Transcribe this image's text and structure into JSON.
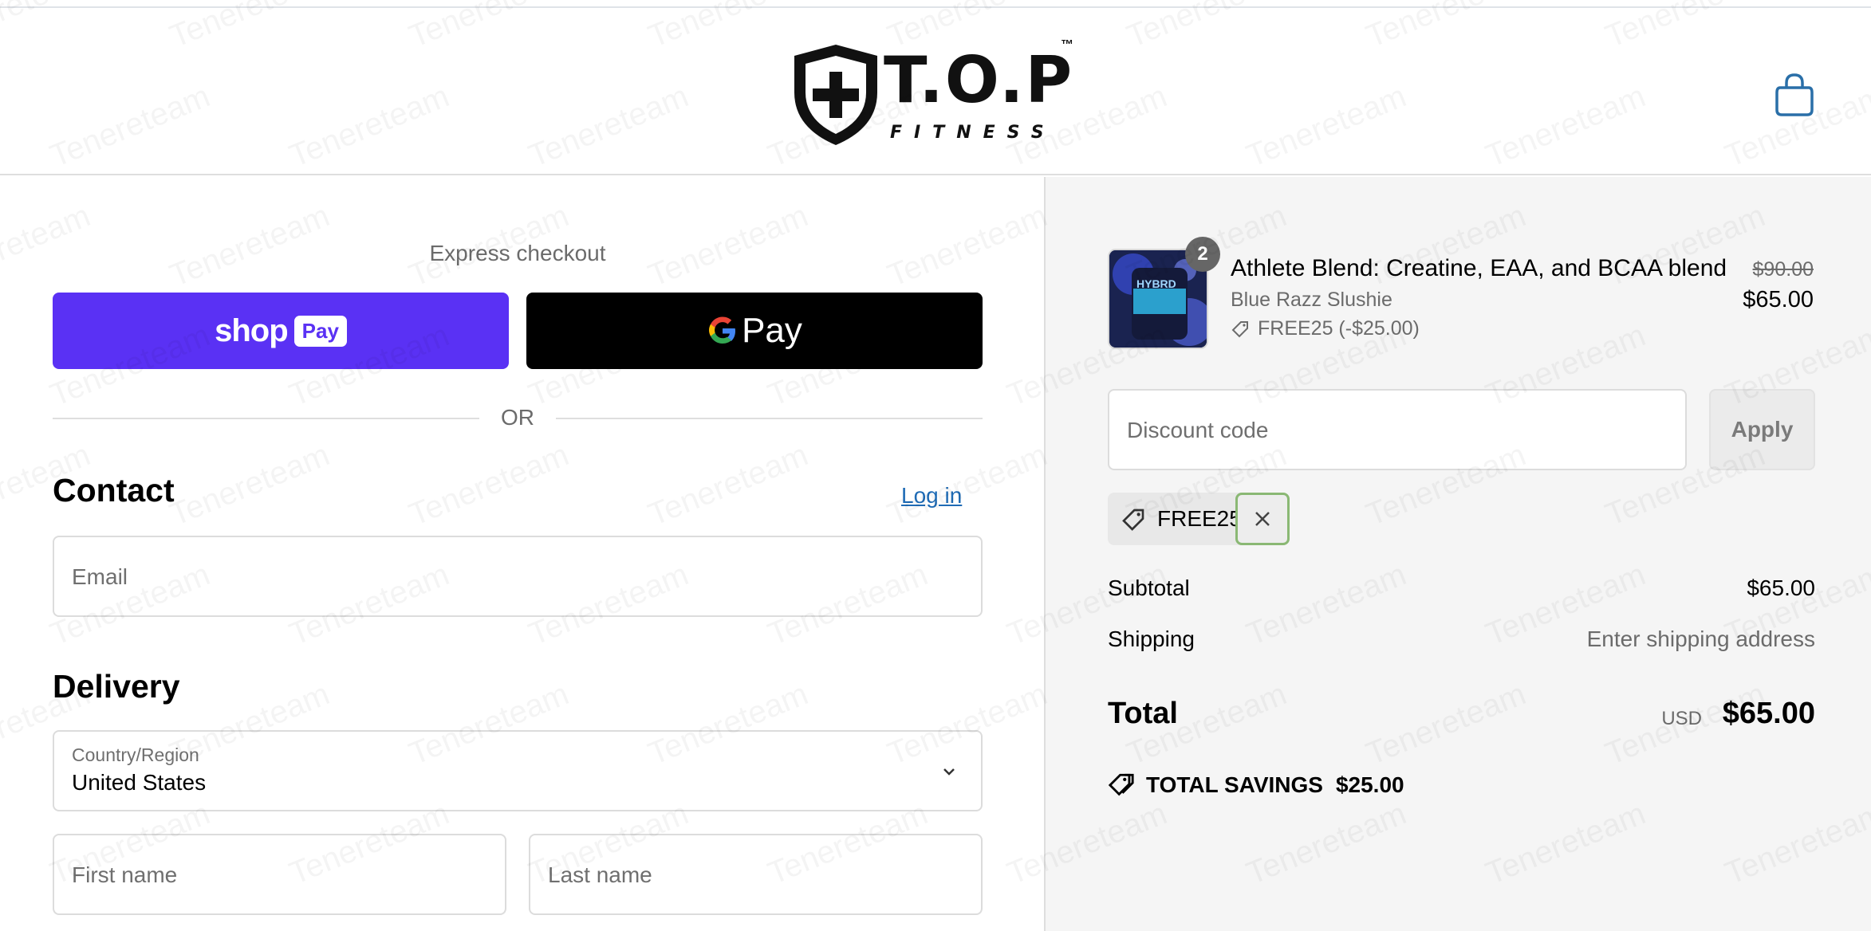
{
  "header": {
    "logo_main": "T.O.P",
    "logo_tm": "™",
    "logo_sub": "FITNESS"
  },
  "express": {
    "label": "Express checkout",
    "shop_pay_text": "shop",
    "shop_pay_badge": "Pay",
    "gpay_text": "Pay",
    "or_label": "OR"
  },
  "contact": {
    "title": "Contact",
    "login_label": "Log in",
    "email_placeholder": "Email"
  },
  "delivery": {
    "title": "Delivery",
    "country_label": "Country/Region",
    "country_value": "United States",
    "first_name_placeholder": "First name",
    "last_name_placeholder": "Last name"
  },
  "order": {
    "item": {
      "quantity": "2",
      "name": "Athlete Blend: Creatine, EAA, and BCAA blend",
      "variant": "Blue Razz Slushie",
      "discount_line": "FREE25 (-$25.00)",
      "original_price": "$90.00",
      "price": "$65.00",
      "image_text": "HYBRD"
    },
    "discount_placeholder": "Discount code",
    "apply_label": "Apply",
    "applied_code": "FREE25",
    "subtotal_label": "Subtotal",
    "subtotal_value": "$65.00",
    "shipping_label": "Shipping",
    "shipping_value": "Enter shipping address",
    "total_label": "Total",
    "currency": "USD",
    "total_value": "$65.00",
    "savings_label": "TOTAL SAVINGS",
    "savings_value": "$25.00"
  },
  "watermark": "Tenereteam",
  "colors": {
    "shop_pay": "#5a31f4",
    "link": "#1f6bb5",
    "summary_bg": "#f5f5f5",
    "remove_focus": "#8ab874"
  }
}
